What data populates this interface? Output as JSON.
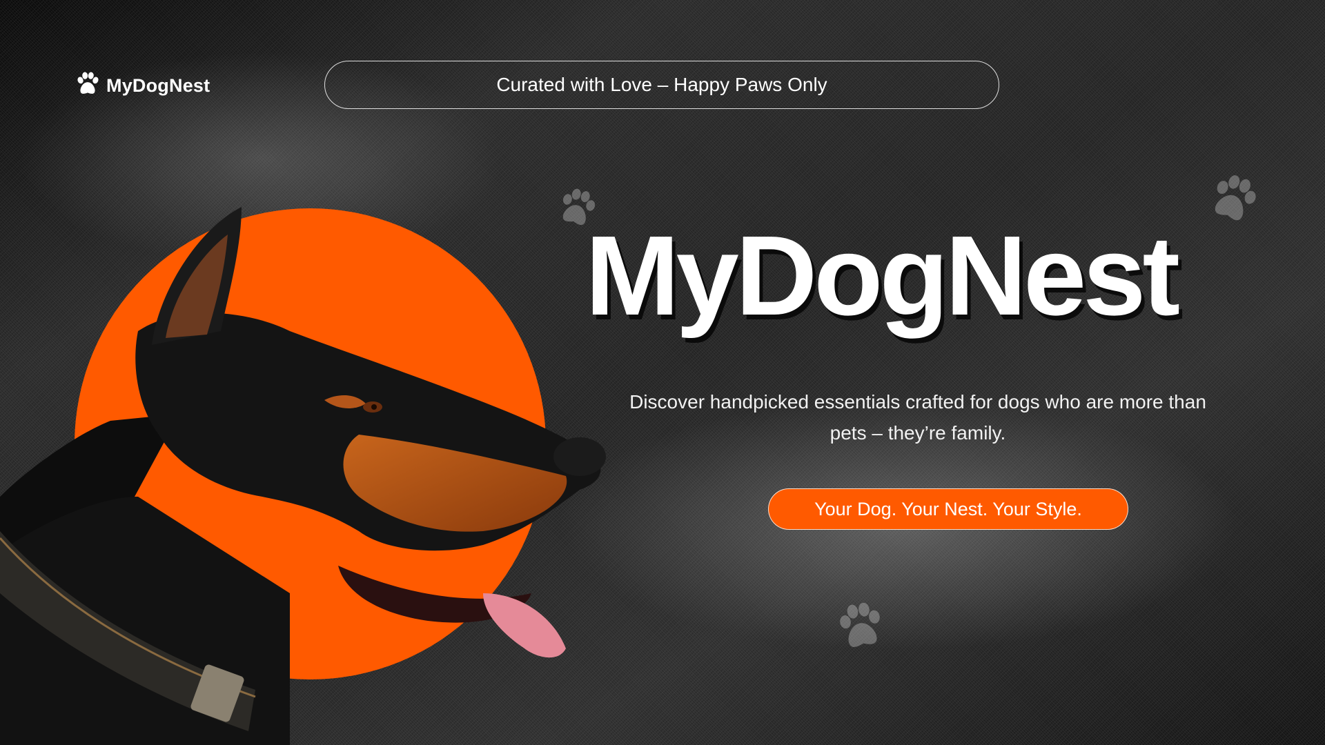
{
  "brand": {
    "logo_text": "MyDogNest",
    "logo_icon": "paw-icon"
  },
  "header": {
    "tagline": "Curated with Love – Happy Paws Only"
  },
  "hero": {
    "title": "MyDogNest",
    "description": "Discover handpicked essentials crafted for dogs who are more than pets – they’re family.",
    "cta_label": "Your Dog. Your Nest. Your Style.",
    "image": "doberman-profile"
  },
  "colors": {
    "accent": "#ff5a00",
    "background": "#262626",
    "text": "#ffffff"
  }
}
